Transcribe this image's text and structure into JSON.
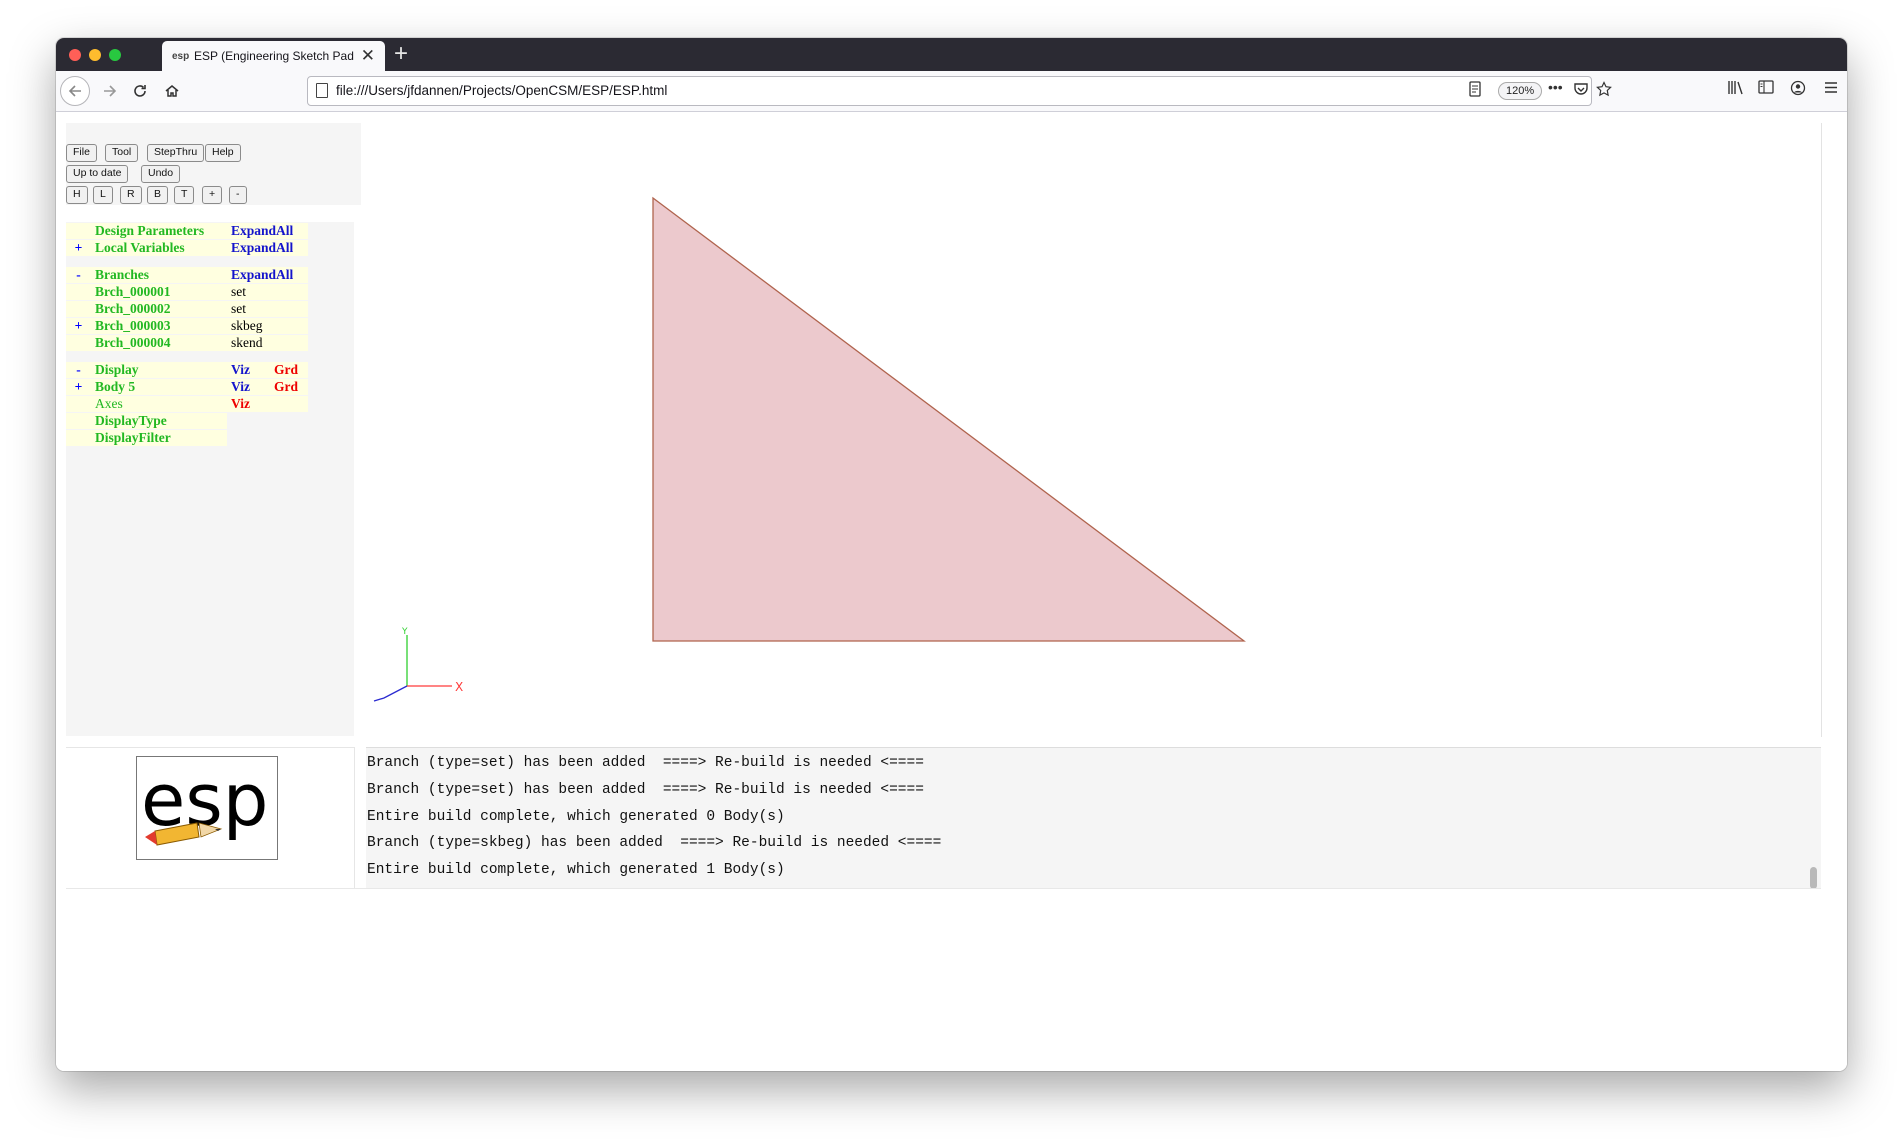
{
  "browser": {
    "tab_favicon": "esp",
    "tab_title": "ESP (Engineering Sketch Pad, V",
    "new_tab": "+",
    "url": "file:///Users/jfdannen/Projects/OpenCSM/ESP/ESP.html",
    "zoom": "120%"
  },
  "toolbar": {
    "row1": [
      "File",
      "Tool",
      "StepThru",
      "Help"
    ],
    "row2": [
      "Up to date",
      "Undo"
    ],
    "row3": [
      "H",
      "L",
      "R",
      "B",
      "T",
      "+",
      "-"
    ]
  },
  "tree": {
    "design_params": {
      "label": "Design Parameters",
      "action": "ExpandAll"
    },
    "local_vars": {
      "toggle": "+",
      "label": "Local Variables",
      "action": "ExpandAll"
    },
    "branches": {
      "toggle": "-",
      "label": "Branches",
      "action": "ExpandAll"
    },
    "branch_items": [
      {
        "toggle": "",
        "name": "Brch_000001",
        "type": "set"
      },
      {
        "toggle": "",
        "name": "Brch_000002",
        "type": "set"
      },
      {
        "toggle": "+",
        "name": "Brch_000003",
        "type": "skbeg"
      },
      {
        "toggle": "",
        "name": "Brch_000004",
        "type": "skend"
      }
    ],
    "display": {
      "toggle": "-",
      "label": "Display",
      "viz": "Viz",
      "grd": "Grd"
    },
    "body5": {
      "toggle": "+",
      "label": "Body 5",
      "viz": "Viz",
      "grd": "Grd"
    },
    "axes": {
      "label": "Axes",
      "viz": "Viz"
    },
    "display_type": "DisplayType",
    "display_filter": "DisplayFilter"
  },
  "logo_text": "esp",
  "viewer": {
    "axis_x": "X",
    "axis_y": "Y",
    "shape_fill": "#ecc9cd",
    "shape_stroke": "#b0644e"
  },
  "messages": [
    "Branch (type=set) has been added  ====> Re-build is needed <====",
    "Branch (type=set) has been added  ====> Re-build is needed <====",
    "Entire build complete, which generated 0 Body(s)",
    "Branch (type=skbeg) has been added  ====> Re-build is needed <====",
    "Entire build complete, which generated 1 Body(s)"
  ]
}
